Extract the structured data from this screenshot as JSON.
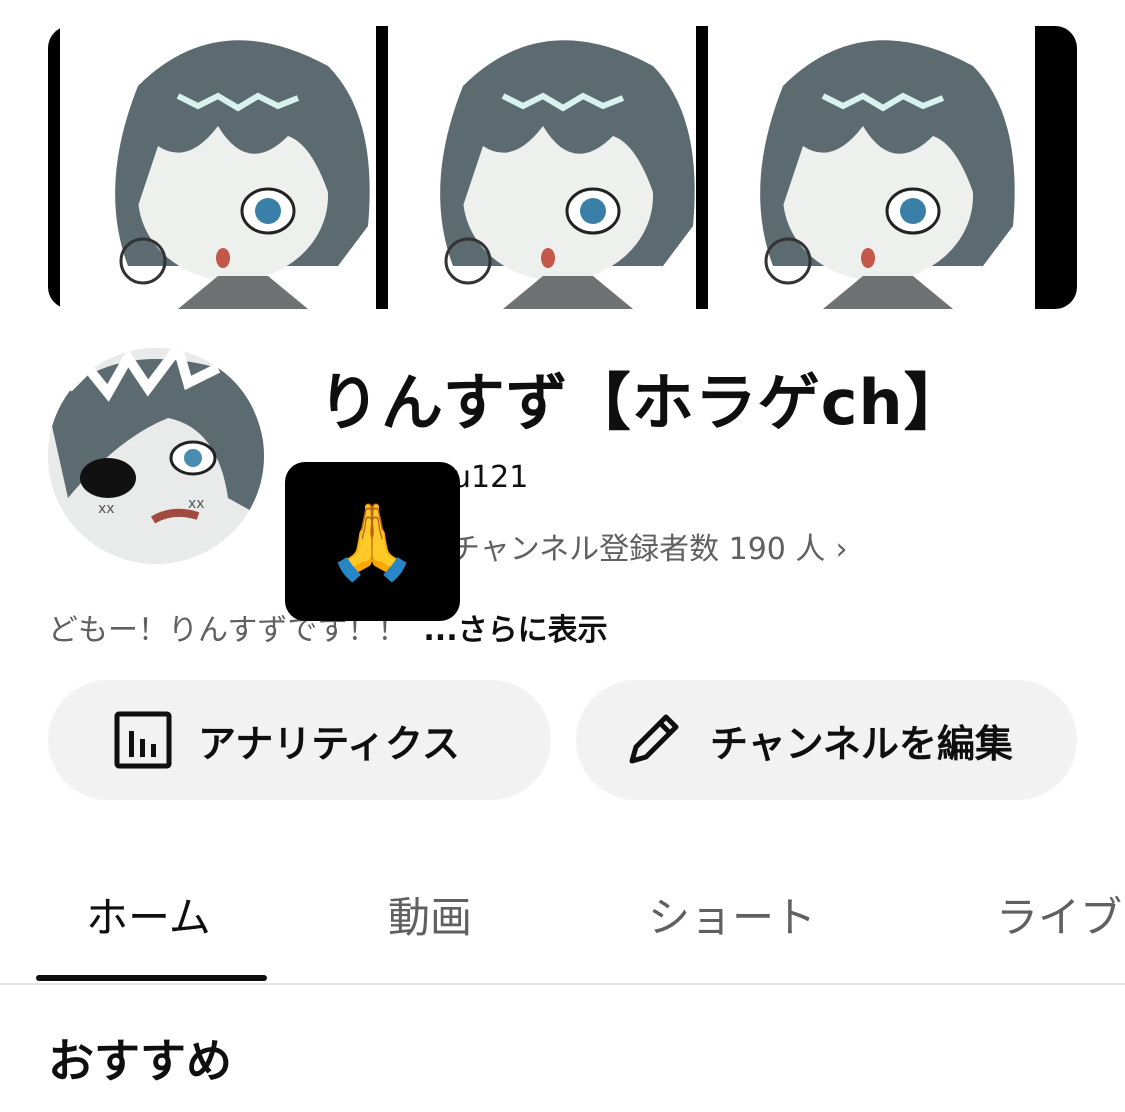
{
  "channel": {
    "title": "りんすず【ホラゲch】",
    "handle_visible": "u121",
    "subscribers": "チャンネル登録者数 190 人",
    "description_visible": "どもー！りんすずです！！",
    "more_label": "...さらに表示"
  },
  "buttons": {
    "analytics_label": "アナリティクス",
    "edit_channel_label": "チャンネルを編集"
  },
  "tabs": [
    {
      "label": "ホーム",
      "active": true
    },
    {
      "label": "動画",
      "active": false
    },
    {
      "label": "ショート",
      "active": false
    },
    {
      "label": "ライブ",
      "active": false
    }
  ],
  "section": {
    "title": "おすすめ"
  },
  "overlay": {
    "emoji": "🙏"
  },
  "icons": {
    "analytics": "bar-chart-icon",
    "edit": "pencil-icon",
    "chevron": "chevron-right-icon"
  },
  "colors": {
    "text_primary": "#0f0f0f",
    "text_secondary": "#606060",
    "button_bg": "#f2f2f2",
    "hair": "#5b6b70",
    "overlay_bg": "#000000"
  }
}
